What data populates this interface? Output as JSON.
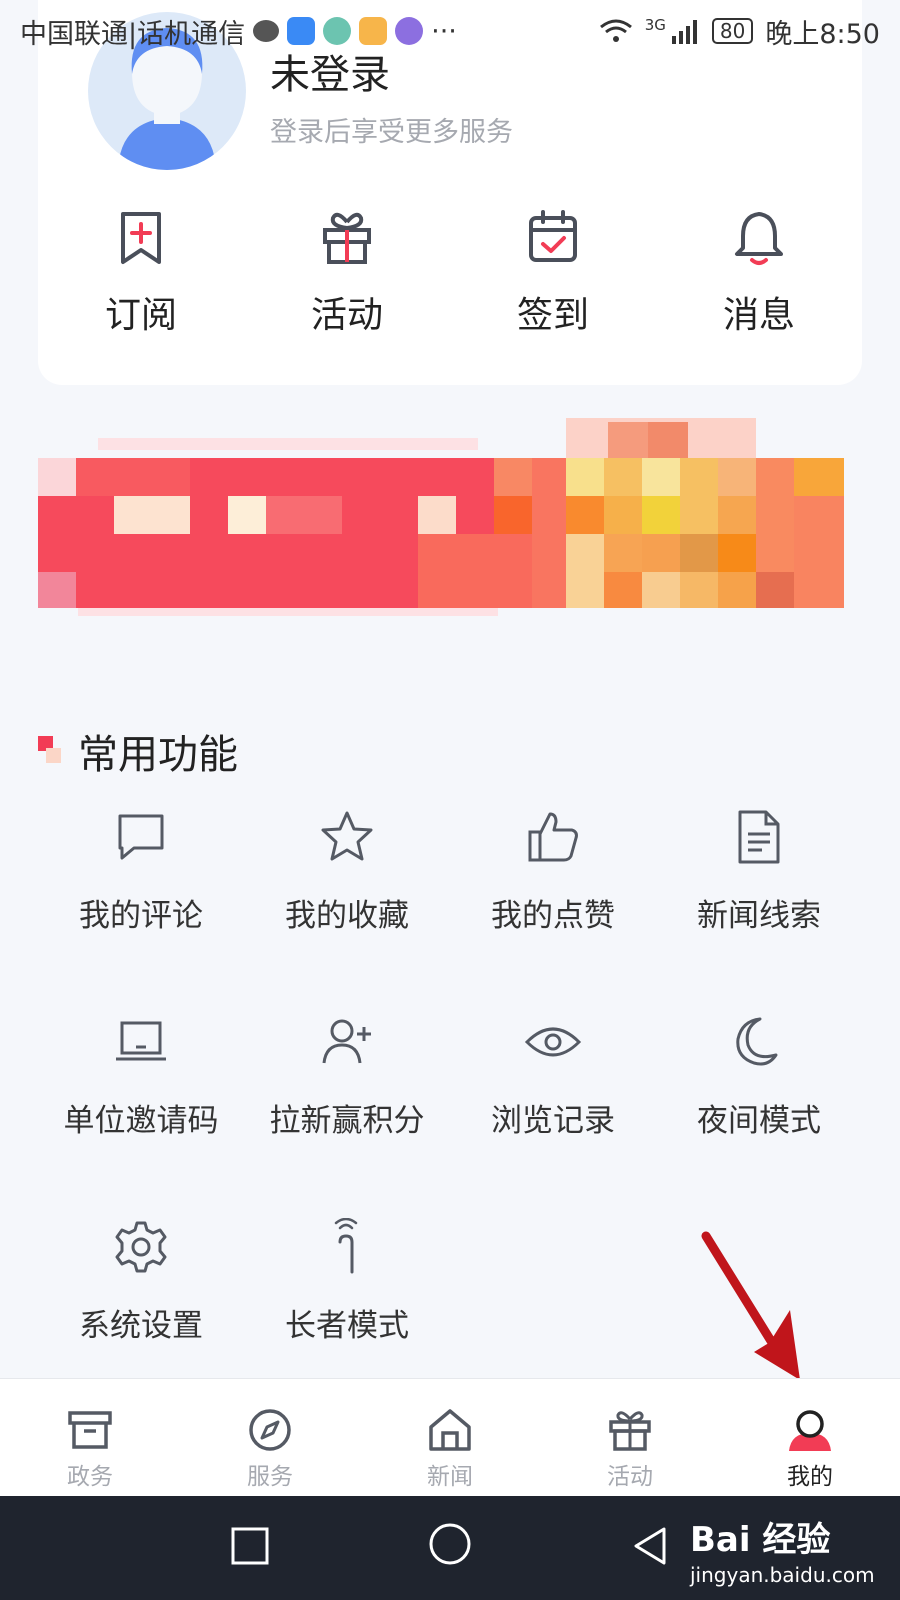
{
  "status_bar": {
    "carrier": "中国联通|话机通信",
    "network": "3G",
    "battery": "80",
    "time": "晚上8:50"
  },
  "profile": {
    "name": "未登录",
    "subtitle": "登录后享受更多服务"
  },
  "quick_actions": [
    {
      "label": "订阅",
      "icon": "bookmark-plus-icon"
    },
    {
      "label": "活动",
      "icon": "gift-icon"
    },
    {
      "label": "签到",
      "icon": "calendar-check-icon"
    },
    {
      "label": "消息",
      "icon": "bell-icon"
    }
  ],
  "section": {
    "title": "常用功能"
  },
  "functions": [
    {
      "label": "我的评论",
      "icon": "comment-icon"
    },
    {
      "label": "我的收藏",
      "icon": "star-icon"
    },
    {
      "label": "我的点赞",
      "icon": "thumbs-up-icon"
    },
    {
      "label": "新闻线索",
      "icon": "document-icon"
    },
    {
      "label": "单位邀请码",
      "icon": "laptop-icon"
    },
    {
      "label": "拉新赢积分",
      "icon": "add-user-icon"
    },
    {
      "label": "浏览记录",
      "icon": "eye-icon"
    },
    {
      "label": "夜间模式",
      "icon": "moon-icon"
    },
    {
      "label": "系统设置",
      "icon": "gear-icon"
    },
    {
      "label": "长者模式",
      "icon": "cane-icon"
    }
  ],
  "bottom_nav": [
    {
      "label": "政务",
      "icon": "archive-box-icon",
      "active": false
    },
    {
      "label": "服务",
      "icon": "compass-icon",
      "active": false
    },
    {
      "label": "新闻",
      "icon": "home-icon",
      "active": false
    },
    {
      "label": "活动",
      "icon": "gift-icon",
      "active": false
    },
    {
      "label": "我的",
      "icon": "user-icon",
      "active": true
    }
  ],
  "watermark": {
    "logo": "Bai 经验",
    "url": "jingyan.baidu.com"
  },
  "colors": {
    "accent": "#f23c55",
    "background": "#f5f7fb",
    "icon_gray": "#555a64",
    "muted_text": "#a6a9b0"
  }
}
